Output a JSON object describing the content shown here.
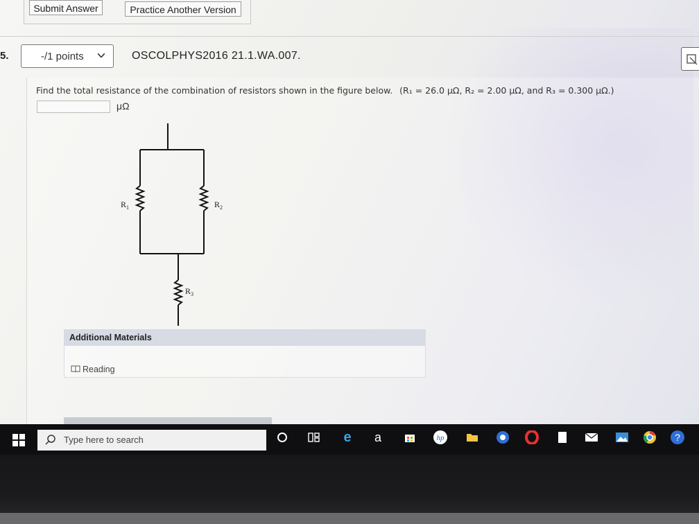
{
  "toolbar": {
    "submit_label": "Submit Answer",
    "practice_label": "Practice Another Version"
  },
  "question": {
    "number": "5.",
    "points_label": "-/1 points",
    "id": "OSCOLPHYS2016 21.1.WA.007.",
    "prompt": "Find the total resistance of the combination of resistors shown in the figure below.",
    "givens": "(R₁ = 26.0 μΩ,  R₂ = 2.00 μΩ,  and R₃ = 0.300 μΩ.)",
    "answer_value": "",
    "answer_unit": "μΩ"
  },
  "figure": {
    "r1_label": "R",
    "r1_sub": "1",
    "r2_label": "R",
    "r2_sub": "2",
    "r3_label": "R",
    "r3_sub": "3"
  },
  "additional_materials": {
    "header": "Additional Materials",
    "reading_label": "Reading"
  },
  "taskbar": {
    "search_placeholder": "Type here to search",
    "icons": [
      "windows-start-icon",
      "search-icon",
      "cortana-icon",
      "task-view-icon",
      "edge-icon",
      "amazon-icon",
      "store-icon",
      "hp-icon",
      "file-explorer-icon",
      "chrome-icon",
      "opera-icon",
      "notes-icon",
      "mail-icon",
      "photos-icon",
      "chrome-icon",
      "help-icon"
    ]
  },
  "colors": {
    "panel_header": "#d6dbe4",
    "taskbar": "#0f0f12",
    "opera_red": "#e8312f",
    "chrome_blue": "#2f6fd6",
    "hp_blue": "#1f6fc7"
  }
}
